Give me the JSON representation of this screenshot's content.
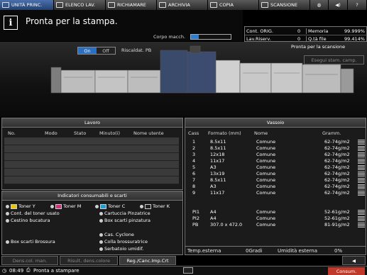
{
  "tabs": [
    {
      "label": "UNITÀ PRINC.",
      "active": true
    },
    {
      "label": "ELENCO LAV.",
      "active": false
    },
    {
      "label": "RICHIAMARE",
      "active": false
    },
    {
      "label": "ARCHIVIA",
      "active": false
    },
    {
      "label": "COPIA",
      "active": false
    },
    {
      "label": "SCANSIONE",
      "active": false
    }
  ],
  "message": "Pronta per la stampa.",
  "body_label": "Corpo macch.",
  "body_level": 0.2,
  "counters": {
    "cont_label": "Cont. ORIG.",
    "cont_value": "0",
    "memory_label": "Memoria",
    "memory_value": "99.999%",
    "reserve_label": "Lav.Riserv.",
    "reserve_value": "0",
    "hdd_label": "Q.tà file",
    "hdd_value": "99.414%"
  },
  "preheat": {
    "on": "On",
    "off": "Off",
    "label": "Riscaldat. PB"
  },
  "scan_status": "Pronta per la scansione",
  "exec_copy": "Esegui stam. camp.",
  "lavoro": {
    "title": "Lavoro",
    "headers": [
      "No.",
      "Modo",
      "Stato",
      "Minuto(i)",
      "Nome utente"
    ]
  },
  "vassoio": {
    "title": "Vassoio",
    "headers": [
      "Cass",
      "Formato (mm)",
      "Nome",
      "Gramm."
    ],
    "rows": [
      {
        "cass": "1",
        "formato": "8.5x11",
        "nome": "Comune",
        "gramm": "62-74g/m2"
      },
      {
        "cass": "2",
        "formato": "8.5x11",
        "nome": "Comune",
        "gramm": "62-74g/m2"
      },
      {
        "cass": "3",
        "formato": "12x18",
        "nome": "Comune",
        "gramm": "62-74g/m2"
      },
      {
        "cass": "4",
        "formato": "11x17",
        "nome": "Comune",
        "gramm": "62-74g/m2"
      },
      {
        "cass": "5",
        "formato": "A3",
        "nome": "Comune",
        "gramm": "62-74g/m2"
      },
      {
        "cass": "6",
        "formato": "13x19",
        "nome": "Comune",
        "gramm": "62-74g/m2"
      },
      {
        "cass": "7",
        "formato": "8.5x11",
        "nome": "Comune",
        "gramm": "62-74g/m2"
      },
      {
        "cass": "8",
        "formato": "A3",
        "nome": "Comune",
        "gramm": "62-74g/m2"
      },
      {
        "cass": "9",
        "formato": "11x17",
        "nome": "Comune",
        "gramm": "62-74g/m2"
      },
      {
        "cass": "PI1",
        "formato": "A4",
        "nome": "Comune",
        "gramm": "52-61g/m2"
      },
      {
        "cass": "PI2",
        "formato": "A4",
        "nome": "Comune",
        "gramm": "52-61g/m2"
      },
      {
        "cass": "PB",
        "formato": "307.0 x 472.0",
        "nome": "Comune",
        "gramm": "81-91g/m2"
      }
    ],
    "temp_label": "Temp.esterna",
    "temp_value": "0Gradi",
    "humidity_label": "Umidità esterna",
    "humidity_value": "0%"
  },
  "consumables": {
    "title": "Indicatori consumabili e scarti",
    "toner": [
      "Toner Y",
      "Toner M",
      "Toner C",
      "Toner K"
    ],
    "used_toner": "Cont. del toner usato",
    "staple_cart": "Cartuccia Pinzatrice",
    "punch_bin": "Cestino bucatura",
    "staple_waste": "Box scarti pinzatura",
    "brossura_waste": "Box scarti Brossura",
    "cyclone": "Cas. Cyclone",
    "glue": "Colla brossuratrice",
    "humid_tank": "Serbatoio umidif."
  },
  "bottom_tabs": [
    "Dens.col. man.",
    "Risult. dens.colore",
    "Reg./Canc.Imp.Crt"
  ],
  "statusbar": {
    "time": "08:49",
    "status": "Pronta a stampare",
    "consum": "Consum."
  },
  "colors": {
    "accent": "#2b6fc0",
    "toner_y": "#e6c800",
    "toner_m": "#d0307a",
    "toner_c": "#1aa0d8",
    "toner_k": "#222222"
  }
}
